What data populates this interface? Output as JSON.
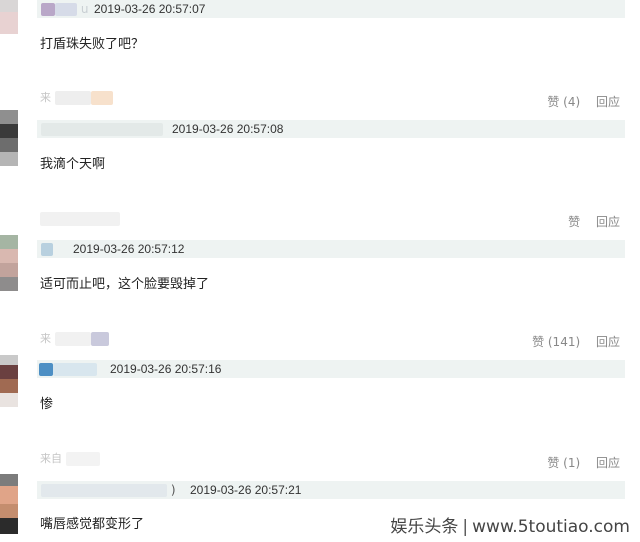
{
  "comments": [
    {
      "time": "2019-03-26 20:57:07",
      "text": "打盾珠失败了吧？",
      "user_hint": "u",
      "source": "",
      "likes": "",
      "reply": ""
    },
    {
      "time": "2019-03-26 20:57:08",
      "text": "我滴个天啊",
      "user_hint": "",
      "source": "来",
      "likes": "赞 (4)",
      "reply": "回应"
    },
    {
      "time": "2019-03-26 20:57:12",
      "text": "适可而止吧，这个脸要毁掉了",
      "user_hint": "",
      "source": "",
      "likes": "赞",
      "reply": "回应"
    },
    {
      "time": "2019-03-26 20:57:16",
      "text": "惨",
      "user_hint": "",
      "source": "来",
      "likes": "赞 (141)",
      "reply": "回应"
    },
    {
      "time": "2019-03-26 20:57:21",
      "text": "嘴唇感觉都变形了",
      "user_hint": ")",
      "source": "来自",
      "likes": "赞 (1)",
      "reply": "回应"
    }
  ],
  "watermark": {
    "brand": "娱乐头条",
    "site": "www.5toutiao.com"
  },
  "colors": {
    "bar": "#eef3f2",
    "text": "#222222",
    "muted": "#888888"
  }
}
